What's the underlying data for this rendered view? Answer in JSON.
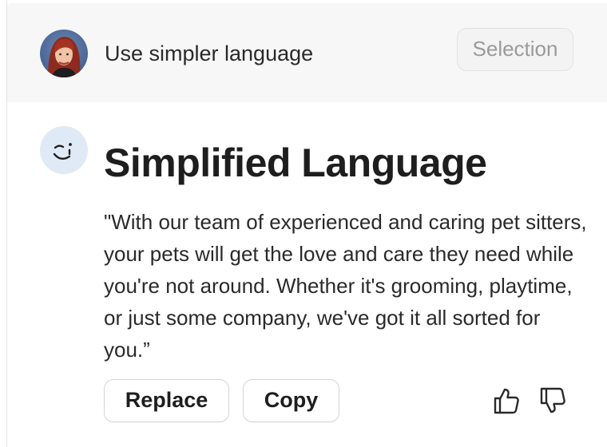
{
  "prompt": {
    "avatar_icon": "user-avatar",
    "text": "Use simpler language",
    "scope_chip": "Selection"
  },
  "response": {
    "assistant_icon": "smiley-face-icon",
    "title": "Simplified Language",
    "body": "\"With our team of experienced and caring pet sitters, your pets will get the love and care they need while you're not around. Whether it's grooming, playtime, or just some company, we've got it all sorted for you.”",
    "actions": {
      "replace_label": "Replace",
      "copy_label": "Copy"
    },
    "feedback": {
      "up_icon": "thumbs-up-icon",
      "down_icon": "thumbs-down-icon"
    }
  },
  "colors": {
    "prompt_background": "#f7f7f7",
    "assistant_icon_background": "#dfeaf6",
    "chip_text": "#9a9a9a",
    "text": "#1f1f1f"
  }
}
